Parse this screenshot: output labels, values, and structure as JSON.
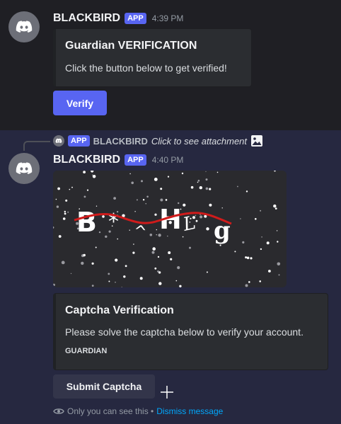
{
  "message1": {
    "author": "BLACKBIRD",
    "tag": "APP",
    "time": "4:39 PM",
    "embed": {
      "title": "Guardian VERIFICATION",
      "description": "Click the button below to get verified!"
    },
    "button": "Verify"
  },
  "reply": {
    "tag": "APP",
    "author": "BLACKBIRD",
    "text": "Click to see attachment",
    "icon": "image-icon"
  },
  "message2": {
    "author": "BLACKBIRD",
    "tag": "APP",
    "time": "4:40 PM",
    "captcha_image": {
      "glyphs": [
        "B",
        "*",
        "^",
        "H",
        "L",
        "g"
      ]
    },
    "embed": {
      "title": "Captcha Verification",
      "description": "Please solve the captcha below to verify your account.",
      "footer": "GUARDIAN"
    },
    "button": "Submit Captcha",
    "ephemeral_notice": "Only you can see this •",
    "dismiss_link": "Dismiss message"
  },
  "colors": {
    "blurple": "#5865f2",
    "captcha_line": "#d01b1b",
    "link": "#00a8fc"
  }
}
